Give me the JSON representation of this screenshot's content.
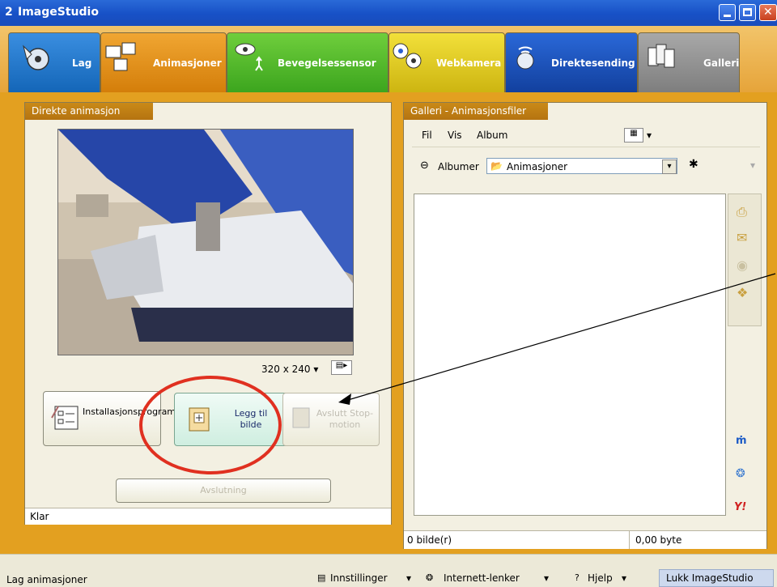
{
  "window": {
    "title": "ImageStudio"
  },
  "tabs": [
    {
      "label": "Lag",
      "icon": "film-reel-icon",
      "color": "#1a74c6"
    },
    {
      "label": "Animasjoner",
      "icon": "animation-icon",
      "color": "#d88a14"
    },
    {
      "label": "Bevegelsessensor",
      "icon": "motion-sensor-icon",
      "color": "#4caf2a"
    },
    {
      "label": "Webkamera",
      "icon": "webcam-icon",
      "color": "#d8c018"
    },
    {
      "label": "Direktesending",
      "icon": "broadcast-icon",
      "color": "#1850b8"
    },
    {
      "label": "Galleri",
      "icon": "gallery-icon",
      "color": "#8a8a8a"
    }
  ],
  "left_panel": {
    "title": "Direkte animasjon",
    "resolution": "320 x 240",
    "install_button": "Installasjonsprogram",
    "add_button": "Legg til bilde",
    "stopmotion_button": "Avslutt Stop-motion",
    "cancel_button": "Avslutning",
    "status": "Klar"
  },
  "gallery": {
    "title": "Galleri - Animasjonsfiler",
    "menu": [
      "Fil",
      "Vis",
      "Album"
    ],
    "albums_label": "Albumer",
    "album_selected": "Animasjoner",
    "count_text": "0 bilde(r)",
    "size_text": "0,00 byte"
  },
  "statusbar": {
    "left_text": "Lag animasjoner",
    "settings": "Innstillinger",
    "links": "Internett-lenker",
    "help": "Hjelp",
    "close": "Lukk ImageStudio"
  },
  "colors": {
    "annotation": "#e03020",
    "accent": "#e3a020"
  }
}
